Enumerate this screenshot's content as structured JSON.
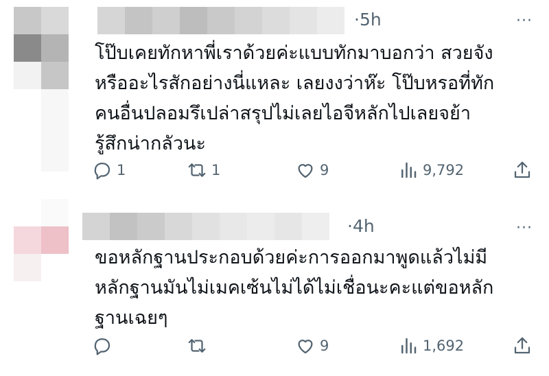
{
  "tweets": [
    {
      "time": "5h",
      "more": "···",
      "text": "โป๊บเคยทักหาพี่เราด้วยค่ะแบบทักมาบอกว่า สวยจัง\nหรืออะไรสักอย่างนี่แหละ เลยงงว่าห๊ะ โป๊บหรอที่ทัก\nคนอื่นปลอมรึเปล่าสรุปไม่เลยไอจีหลักไปเลยจย้า\nรู้สึกน่ากลัวนะ",
      "actions": {
        "reply": "1",
        "retweet": "1",
        "like": "9",
        "views": "9,792"
      }
    },
    {
      "time": "4h",
      "more": "···",
      "text": "ขอหลักฐานประกอบด้วยค่ะการออกมาพูดแล้วไม่มี\nหลักฐานมันไม่เมคเซ้นไม่ได้ไม่เชื่อนะคะแต่ขอหลัก\nฐานเฉยๆ",
      "actions": {
        "reply": "",
        "retweet": "",
        "like": "9",
        "views": "1,692"
      }
    }
  ],
  "icons": {
    "reply": "reply-icon",
    "retweet": "retweet-icon",
    "like": "heart-icon",
    "views": "views-icon",
    "share": "share-icon",
    "more": "more-icon"
  },
  "colors": {
    "text": "#0f1419",
    "secondary": "#536471"
  }
}
